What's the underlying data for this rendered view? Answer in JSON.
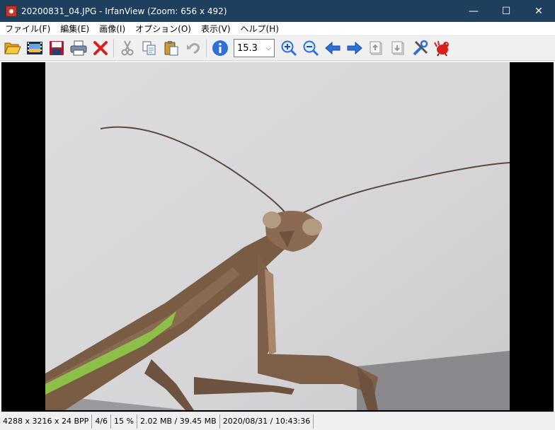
{
  "window": {
    "title": "20200831_04.JPG - IrfanView (Zoom: 656 x 492)",
    "app_icon": "irfanview-icon",
    "controls": {
      "minimize": "—",
      "maximize": "☐",
      "close": "✕"
    }
  },
  "menu": {
    "items": [
      {
        "label": "ファイル(F)"
      },
      {
        "label": "編集(E)"
      },
      {
        "label": "画像(I)"
      },
      {
        "label": "オプション(O)"
      },
      {
        "label": "表示(V)"
      },
      {
        "label": "ヘルプ(H)"
      }
    ]
  },
  "toolbar": {
    "icons": [
      "open-folder-icon",
      "slideshow-icon",
      "save-icon",
      "print-icon",
      "delete-icon",
      "cut-icon",
      "copy-icon",
      "paste-icon",
      "undo-icon",
      "info-icon",
      "zoom-in-icon",
      "zoom-out-icon",
      "previous-icon",
      "next-icon",
      "first-page-icon",
      "last-page-icon",
      "settings-icon",
      "irfanview-icon"
    ],
    "zoom_value": "15.3"
  },
  "image": {
    "background": "#d8d8da",
    "subject": "praying-mantis"
  },
  "status": {
    "dimensions": "4288 x 3216 x 24 BPP",
    "position": "4/6",
    "zoom": "15 %",
    "size": "2.02 MB / 39.45 MB",
    "datetime": "2020/08/31 / 10:43:36"
  },
  "colors": {
    "titlebar": "#1e3f5e",
    "accent_blue": "#2e6fd8",
    "delete_red": "#d6201c"
  }
}
